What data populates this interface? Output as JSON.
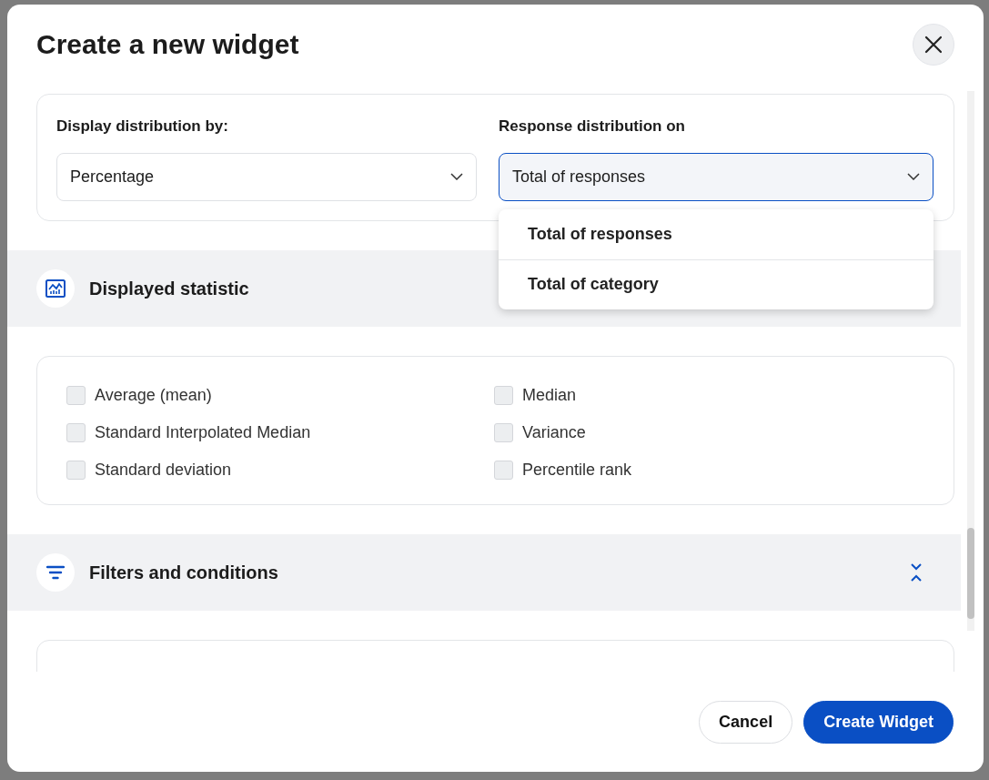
{
  "dialog": {
    "title": "Create a new widget"
  },
  "distribution": {
    "display_by": {
      "label": "Display distribution by:",
      "value": "Percentage",
      "open": false
    },
    "response_on": {
      "label": "Response distribution on",
      "value": "Total of responses",
      "open": true,
      "options": [
        {
          "label": "Total of responses"
        },
        {
          "label": "Total of category"
        }
      ]
    }
  },
  "sections": [
    {
      "kind": "statistics",
      "title": "Displayed statistic",
      "expanded": true,
      "options": [
        {
          "label": "Average (mean)",
          "checked": false
        },
        {
          "label": "Median",
          "checked": false
        },
        {
          "label": "Standard Interpolated Median",
          "checked": false
        },
        {
          "label": "Variance",
          "checked": false
        },
        {
          "label": "Standard deviation",
          "checked": false
        },
        {
          "label": "Percentile rank",
          "checked": false
        }
      ]
    },
    {
      "kind": "filters",
      "title": "Filters and conditions",
      "expanded": true
    }
  ],
  "buttons": [
    {
      "kind": "secondary",
      "label": "Cancel"
    },
    {
      "kind": "primary",
      "label": "Create Widget"
    }
  ]
}
